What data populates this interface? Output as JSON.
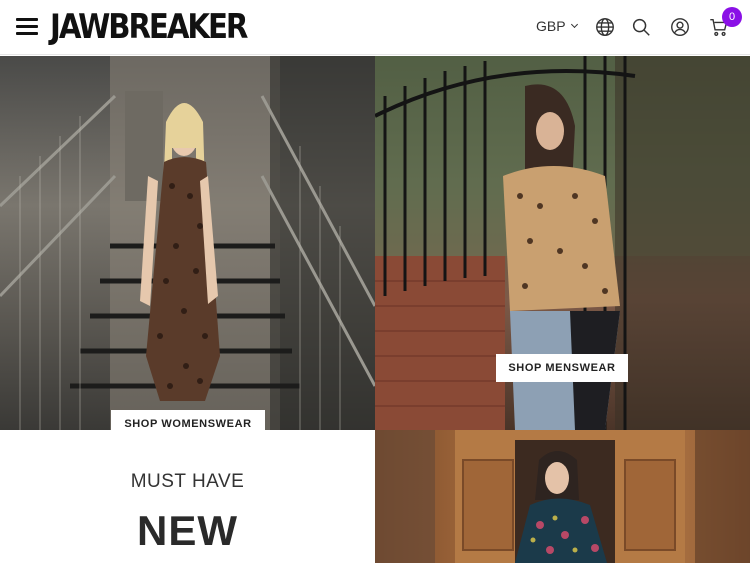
{
  "header": {
    "logo": "JAWBREAKER",
    "currency": "GBP",
    "cart_count": "0"
  },
  "hero": {
    "women_button": "SHOP WOMENSWEAR",
    "men_button": "SHOP MENSWEAR"
  },
  "promo": {
    "subtitle": "MUST HAVE",
    "title": "NEW"
  },
  "icons": {
    "menu": "hamburger-menu-icon",
    "globe": "globe-icon",
    "search": "search-icon",
    "account": "user-icon",
    "cart": "cart-icon"
  },
  "colors": {
    "accent": "#8a10e6",
    "text": "#111111"
  }
}
